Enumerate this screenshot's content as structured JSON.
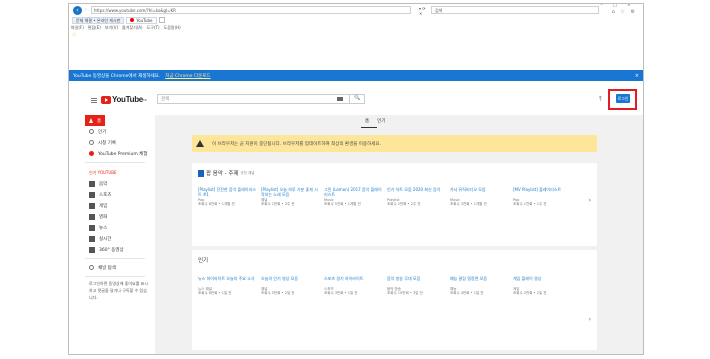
{
  "browser": {
    "url": "https://www.youtube.com/?hl=ko&gl=KR",
    "url_tools": "▾ ⟳ ✕",
    "search_placeholder": "검색",
    "tabs": [
      {
        "label": "문제 해결 • 온라인 게시판"
      },
      {
        "label": "YouTube"
      }
    ],
    "menu": [
      "파일(F)",
      "편집(E)",
      "보기(V)",
      "즐겨찾기(A)",
      "도구(T)",
      "도움말(H)"
    ],
    "fav_icon": "☆",
    "win_controls": "– □ ×",
    "win_icons": "⌂ ☆ ⚙"
  },
  "notification": {
    "text": "YouTube 동영상을 Chrome에서 재생하세요.",
    "link": "지금 Chrome 다운로드",
    "close": "×"
  },
  "youtube": {
    "logo_text": "YouTube",
    "logo_region": "KR",
    "search_placeholder": "검색",
    "search_button": "🔍",
    "upload_icon": "⤒",
    "login_label": "로그인"
  },
  "sidebar": {
    "items": [
      {
        "label": "홈",
        "icon": "home-icon"
      },
      {
        "label": "인기",
        "icon": "fire-icon"
      },
      {
        "label": "시청 기록",
        "icon": "history-icon"
      },
      {
        "label": "YouTube Premium 체험",
        "icon": "premium-icon"
      }
    ],
    "section_title": "인기 YOUTUBE",
    "categories": [
      "음악",
      "스포츠",
      "게임",
      "영화",
      "뉴스",
      "실시간",
      "360° 동영상"
    ],
    "browse_label": "채널 탐색",
    "login_prompt": "로그인하면 동영상에 좋아요를 표시하고 댓글을 달거나 구독할 수 있습니다."
  },
  "main": {
    "tabs": [
      "홈",
      "인기"
    ],
    "warning": "이 브라우저는 곧 지원이 중단됩니다. 브라우저를 업데이트하여 최상의 환경을 이용하세요.",
    "section1": {
      "title": "팝 음악 - 주제",
      "subtitle": "추천 채널",
      "cards": [
        {
          "title": "[Playlist] 잔잔한 음악 플레이리스트 #1",
          "channel": "Pop",
          "meta": "조회수 8천회 • 1개월 전"
        },
        {
          "title": "[Playlist] 오늘 하루 기분 좋게 시작하는 노래 모음",
          "channel": "채널",
          "meta": "조회수 1만회 • 3주 전"
        },
        {
          "title": "그린 (Lemon) 2017 음악 플레이리스트",
          "channel": "Music",
          "meta": "조회수 5천회 • 1개월 전"
        },
        {
          "title": "인기 차트 모음 2020 최신 음악",
          "channel": "Playlist",
          "meta": "조회수 2만회 • 2주 전"
        },
        {
          "title": "가사 뮤직비디오 모음",
          "channel": "Music",
          "meta": "조회수 3천회 • 1개월 전"
        },
        {
          "title": "[MV Playlist] 플레이리스트",
          "channel": "Pop",
          "meta": "조회수 1천회 • 1주 전"
        }
      ]
    },
    "section2": {
      "title": "인기",
      "cards": [
        {
          "title": "뉴스 하이라이트 오늘의 주요 소식",
          "channel": "뉴스 채널",
          "meta": "조회수 8만회 • 1일 전"
        },
        {
          "title": "오늘의 인기 영상 모음",
          "channel": "채널",
          "meta": "조회수 5만회 • 2일 전"
        },
        {
          "title": "스포츠 경기 하이라이트",
          "channel": "스포츠",
          "meta": "조회수 3만회 • 1일 전"
        },
        {
          "title": "음악 방송 무대 모음",
          "channel": "음악 방송",
          "meta": "조회수 10만회 • 3일 전"
        },
        {
          "title": "예능 클립 명장면 모음",
          "channel": "예능",
          "meta": "조회수 4만회 • 1일 전"
        },
        {
          "title": "게임 플레이 영상",
          "channel": "게임",
          "meta": "조회수 2만회 • 2일 전"
        }
      ]
    },
    "chevron": "›"
  },
  "colors": {
    "youtube_red": "#e62117",
    "notify_blue": "#1976d2",
    "warning_yellow": "#fde69a",
    "highlight_red": "#e31b23"
  }
}
